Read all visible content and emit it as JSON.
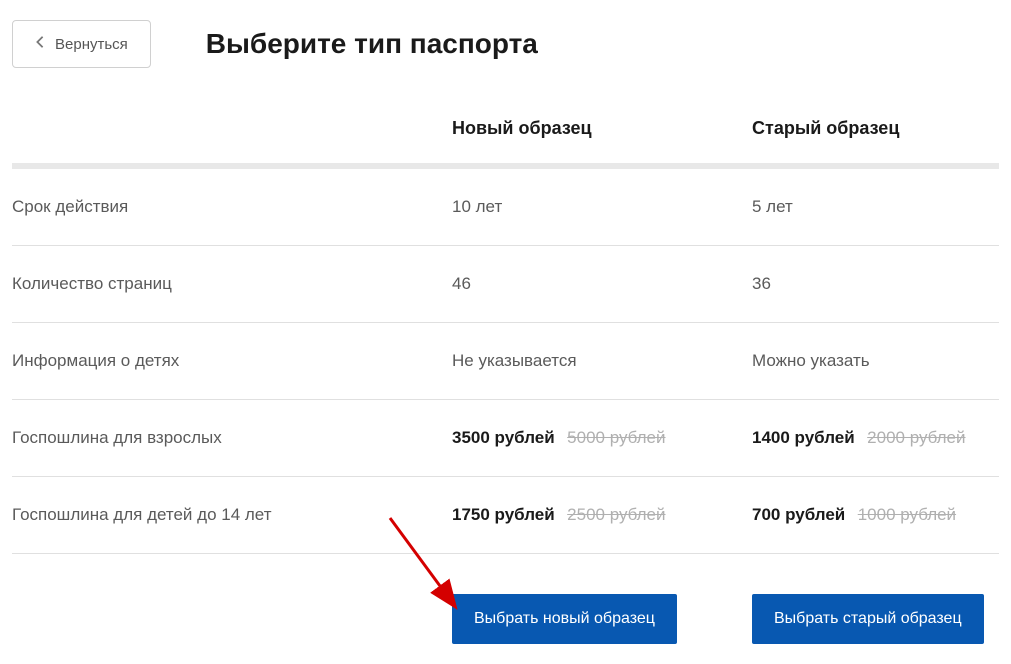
{
  "header": {
    "back_label": "Вернуться",
    "title": "Выберите тип паспорта"
  },
  "columns": {
    "new": "Новый образец",
    "old": "Старый образец"
  },
  "rows": [
    {
      "label": "Срок действия",
      "new": {
        "text": "10 лет"
      },
      "old": {
        "text": "5 лет"
      }
    },
    {
      "label": "Количество страниц",
      "new": {
        "text": "46"
      },
      "old": {
        "text": "36"
      }
    },
    {
      "label": "Информация о детях",
      "new": {
        "text": "Не указывается"
      },
      "old": {
        "text": "Можно указать"
      }
    },
    {
      "label": "Госпошлина для взрослых",
      "new": {
        "price": "3500 рублей",
        "old_price": "5000 рублей"
      },
      "old": {
        "price": "1400 рублей",
        "old_price": "2000 рублей"
      }
    },
    {
      "label": "Госпошлина для детей до 14 лет",
      "new": {
        "price": "1750 рублей",
        "old_price": "2500 рублей"
      },
      "old": {
        "price": "700 рублей",
        "old_price": "1000 рублей"
      }
    }
  ],
  "buttons": {
    "select_new": "Выбрать новый образец",
    "select_old": "Выбрать старый образец"
  }
}
